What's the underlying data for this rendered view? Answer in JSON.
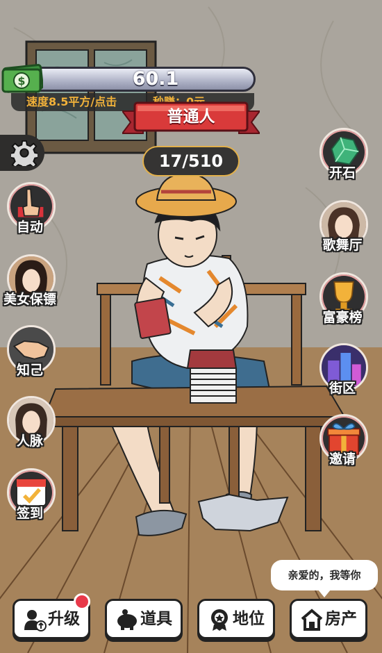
{
  "currency": {
    "amount": "60.1",
    "speed_text": "速度8.5平方/点击",
    "per_second_text": "秒赚：0元"
  },
  "rank": {
    "title": "普通人",
    "progress_text": "17/510",
    "progress_current": 17,
    "progress_total": 510
  },
  "settings": {
    "icon": "gear-icon"
  },
  "left_buttons": [
    {
      "label": "自动",
      "icon": "tap-hand-icon"
    },
    {
      "label": "美女保镖",
      "icon": "bodyguard-portrait-icon"
    },
    {
      "label": "知己",
      "icon": "handshake-icon"
    },
    {
      "label": "人脉",
      "icon": "contact-portrait-icon"
    },
    {
      "label": "签到",
      "icon": "calendar-check-icon"
    }
  ],
  "right_buttons": [
    {
      "label": "开石",
      "icon": "gem-stone-icon"
    },
    {
      "label": "歌舞厅",
      "icon": "dancer-portrait-icon"
    },
    {
      "label": "富豪榜",
      "icon": "trophy-icon"
    },
    {
      "label": "街区",
      "icon": "city-block-icon"
    },
    {
      "label": "邀请",
      "icon": "gift-box-icon"
    }
  ],
  "bubble": {
    "text": "亲爱的，我等你"
  },
  "nav": [
    {
      "label": "升级",
      "icon": "upgrade-person-icon",
      "has_badge": true
    },
    {
      "label": "道具",
      "icon": "piggy-bank-icon",
      "has_badge": false
    },
    {
      "label": "地位",
      "icon": "medal-icon",
      "has_badge": false
    },
    {
      "label": "房产",
      "icon": "house-icon",
      "has_badge": false
    }
  ],
  "colors": {
    "wall": "#a8a39b",
    "floor": "#a9865f",
    "accent_gold": "#f2b23a",
    "ribbon_red": "#d93a3a",
    "badge_red": "#e8394a"
  }
}
